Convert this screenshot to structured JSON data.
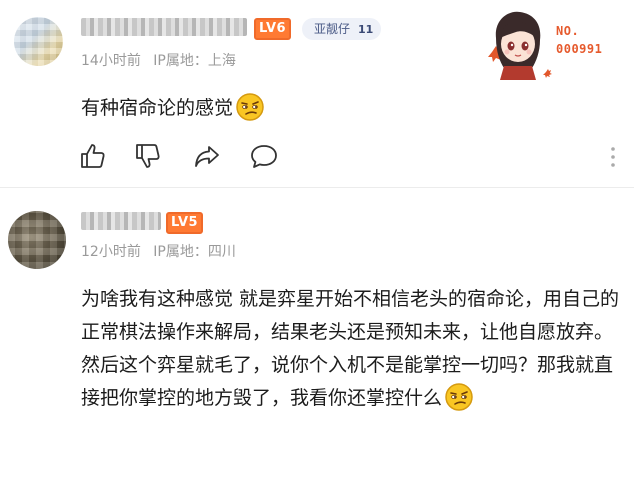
{
  "comments": [
    {
      "username": "",
      "level": "LV6",
      "fan_badge": {
        "name": "亚靓仔",
        "level": "11"
      },
      "time": "14小时前",
      "ip_location": "IP属地：上海",
      "text": "有种宿命论的感觉",
      "emoji": "smirk-emoji",
      "actions": {
        "like": "thumbs-up-icon",
        "dislike": "thumbs-down-icon",
        "share": "share-icon",
        "reply": "comment-icon",
        "more": "more-vertical-icon"
      }
    },
    {
      "username": "",
      "level": "LV5",
      "time": "12小时前",
      "ip_location": "IP属地：四川",
      "text": "为啥我有这种感觉  就是弈星开始不相信老头的宿命论，用自己的正常棋法操作来解局，结果老头还是预知未来，让他自愿放弃。然后这个弈星就毛了，说你个入机不是能掌控一切吗？那我就直接把你掌控的地方毁了，我看你还掌控什么",
      "emoji": "smirk-emoji"
    }
  ],
  "sticker": {
    "label": "NO.",
    "number": "000991"
  },
  "colors": {
    "level_badge": "#ff7a33",
    "fan_badge_bg": "#eef1f8",
    "meta_text": "#9a9a9a",
    "body_text": "#1c1c1c",
    "sticker_accent": "#e65a2d"
  }
}
